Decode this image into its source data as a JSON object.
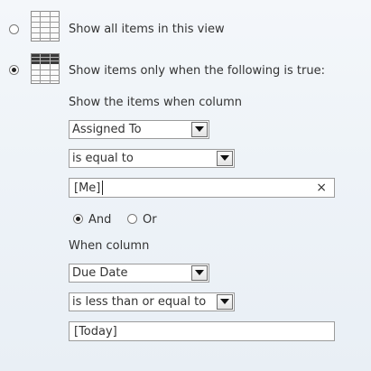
{
  "filter_mode": {
    "show_all_label": "Show all items in this view",
    "show_only_label": "Show items only when the following is true:",
    "selected": "show_only"
  },
  "condition1": {
    "heading": "Show the items when column",
    "column": "Assigned To",
    "operator": "is equal to",
    "value": "[Me]",
    "clear_symbol": "×"
  },
  "logic": {
    "and_label": "And",
    "or_label": "Or",
    "selected": "and"
  },
  "condition2": {
    "heading": "When column",
    "column": "Due Date",
    "operator": "is less than or equal to",
    "value": "[Today]"
  },
  "icons": {
    "show_all": "table-grid-icon",
    "show_only": "filtered-table-icon"
  }
}
